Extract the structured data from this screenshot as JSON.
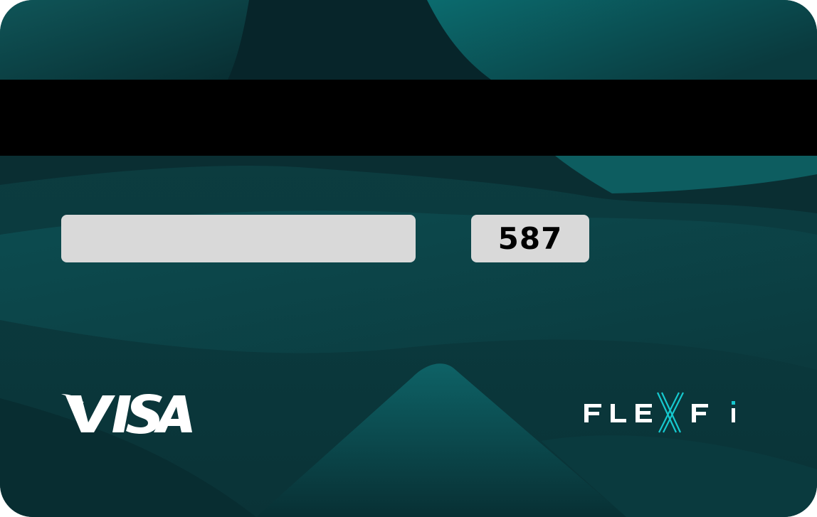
{
  "card": {
    "cvv": "587",
    "network_logo": "VISA",
    "brand_logo": "FLEXFi",
    "colors": {
      "background": "#0b3b3f",
      "accent": "#16c9cf",
      "stripe": "#000000",
      "panel": "#d9d9d9"
    },
    "icons": [
      "visa-logo",
      "flexfi-logo"
    ]
  }
}
